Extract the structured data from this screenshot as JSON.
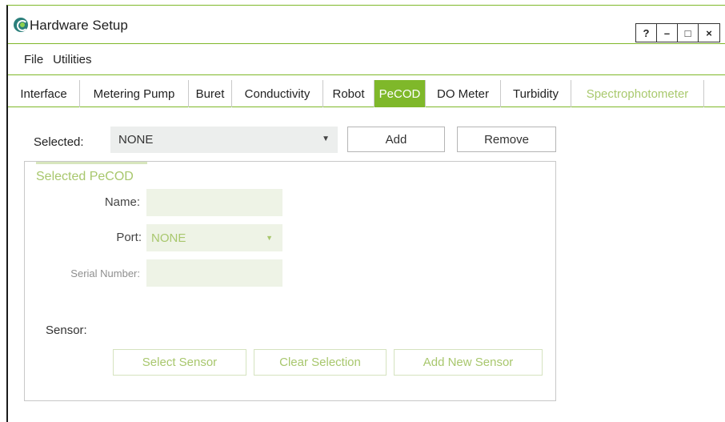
{
  "window": {
    "title": "Hardware Setup",
    "controls": {
      "help": "?",
      "minimize": "–",
      "maximize": "□",
      "close": "×"
    }
  },
  "menu": {
    "items": [
      "File",
      "Utilities"
    ]
  },
  "tabs": [
    {
      "label": "Interface",
      "state": "normal"
    },
    {
      "label": "Metering Pump",
      "state": "normal"
    },
    {
      "label": "Buret",
      "state": "normal"
    },
    {
      "label": "Conductivity",
      "state": "normal"
    },
    {
      "label": "Robot",
      "state": "normal"
    },
    {
      "label": "PeCOD",
      "state": "active"
    },
    {
      "label": "DO Meter",
      "state": "normal"
    },
    {
      "label": "Turbidity",
      "state": "normal"
    },
    {
      "label": "Spectrophotometer",
      "state": "disabled"
    }
  ],
  "selection": {
    "label": "Selected:",
    "value": "NONE",
    "add_label": "Add",
    "remove_label": "Remove"
  },
  "group": {
    "title": "Selected PeCOD",
    "name_label": "Name:",
    "name_value": "",
    "port_label": "Port:",
    "port_value": "NONE",
    "serial_label": "Serial Number:",
    "serial_value": "",
    "sensor_label": "Sensor:",
    "select_sensor_label": "Select Sensor",
    "clear_selection_label": "Clear Selection",
    "add_new_sensor_label": "Add New Sensor"
  },
  "colors": {
    "accent": "#7fb82a",
    "accent_light": "#a8c76d",
    "field_bg": "#eef3e6"
  }
}
